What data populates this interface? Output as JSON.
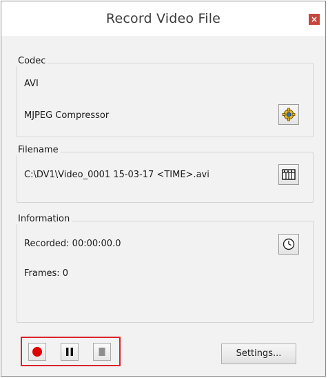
{
  "window": {
    "title": "Record Video File",
    "close_glyph": "×"
  },
  "codec": {
    "legend": "Codec",
    "container": "AVI",
    "compressor": "MJPEG Compressor",
    "settings_icon": "gear-settings-icon"
  },
  "filename": {
    "legend": "Filename",
    "path": "C:\\DV1\\Video_0001 15-03-17 <TIME>.avi",
    "browse_icon": "film-folder-icon"
  },
  "information": {
    "legend": "Information",
    "recorded": "Recorded: 00:00:00.0",
    "frames": "Frames: 0",
    "timer_icon": "clock-icon"
  },
  "controls": {
    "record_icon": "record-icon",
    "pause_icon": "pause-icon",
    "stop_icon": "stop-icon",
    "highlight_color": "#d9232b"
  },
  "buttons": {
    "settings": "Settings..."
  }
}
